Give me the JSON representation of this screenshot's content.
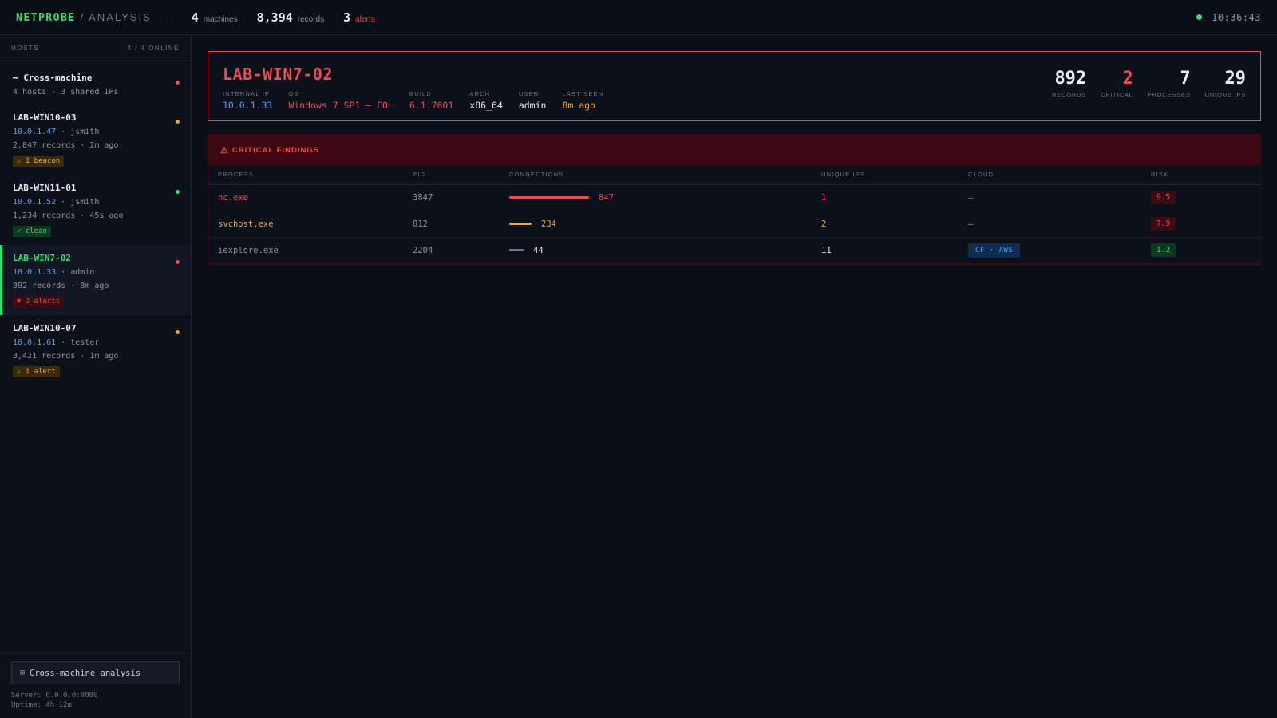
{
  "topbar": {
    "brand": "NETPROBE",
    "brand_sub": "/ ANALYSIS",
    "machines_count": "4",
    "machines_label": "machines",
    "records_count": "8,394",
    "records_label": "records",
    "alerts_count": "3",
    "alerts_label": "alerts",
    "clock": "10:36:43"
  },
  "sidebar": {
    "hosts_label": "HOSTS",
    "online_label": "4 / 4 ONLINE",
    "hosts": [
      {
        "name": "— Cross-machine",
        "line1": "4 hosts · 3 shared IPs",
        "dot_color": "#f0494f"
      },
      {
        "name": "LAB-WIN10-03",
        "ip": "10.0.1.47",
        "user": " · jsmith",
        "line2": "2,847 records · 2m ago",
        "badge": "⚠ 1 beacon",
        "dot_color": "#f5a623"
      },
      {
        "name": "LAB-WIN11-01",
        "ip": "10.0.1.52",
        "user": " · jsmith",
        "line2": "1,234 records · 45s ago",
        "badge": "✓ clean",
        "dot_color": "#2ee07a"
      },
      {
        "name": "LAB-WIN7-02",
        "ip": "10.0.1.33",
        "user": " · admin",
        "line2": "892 records · 8m ago",
        "badge": "✖ 2 alerts",
        "dot_color": "#f0494f"
      },
      {
        "name": "LAB-WIN10-07",
        "ip": "10.0.1.61",
        "user": " · tester",
        "line2": "3,421 records · 1m ago",
        "badge": "⚠ 1 alert",
        "dot_color": "#f5a623"
      }
    ],
    "cross_button": "Cross-machine analysis",
    "server": "Server: 0.0.0.0:8080",
    "uptime": "Uptime: 4h 12m"
  },
  "detail": {
    "title": "LAB-WIN7-02",
    "meta": [
      {
        "k": "INTERNAL IP",
        "v": "10.0.1.33"
      },
      {
        "k": "OS",
        "v": "Windows 7 SP1 — EOL"
      },
      {
        "k": "BUILD",
        "v": "6.1.7601"
      },
      {
        "k": "ARCH",
        "v": "x86_64"
      },
      {
        "k": "USER",
        "v": "admin"
      },
      {
        "k": "LAST SEEN",
        "v": "8m ago"
      }
    ],
    "kpis": [
      {
        "n": "892",
        "l": "RECORDS"
      },
      {
        "n": "2",
        "l": "CRITICAL"
      },
      {
        "n": "7",
        "l": "PROCESSES"
      },
      {
        "n": "29",
        "l": "UNIQUE IPS"
      }
    ]
  },
  "findings": {
    "title": "CRITICAL FINDINGS",
    "columns": [
      "PROCESS",
      "PID",
      "CONNECTIONS",
      "UNIQUE IPS",
      "CLOUD",
      "RISK"
    ],
    "rows": [
      {
        "process": "nc.exe",
        "pid": "3847",
        "connections": 847,
        "connections_label": "847",
        "unique_ips": "1",
        "cloud": "—",
        "risk": "9.5"
      },
      {
        "process": "svchost.exe",
        "pid": "812",
        "connections": 234,
        "connections_label": "234",
        "unique_ips": "2",
        "cloud": "—",
        "risk": "7.9"
      },
      {
        "process": "iexplore.exe",
        "pid": "2204",
        "connections": 44,
        "connections_label": "44",
        "unique_ips": "11",
        "cloud": "CF · AWS",
        "risk": "1.2"
      }
    ]
  },
  "colors": {
    "accent": "#2ee07a",
    "danger": "#f0494f",
    "warning": "#f5a623",
    "info": "#4ea1ff"
  }
}
